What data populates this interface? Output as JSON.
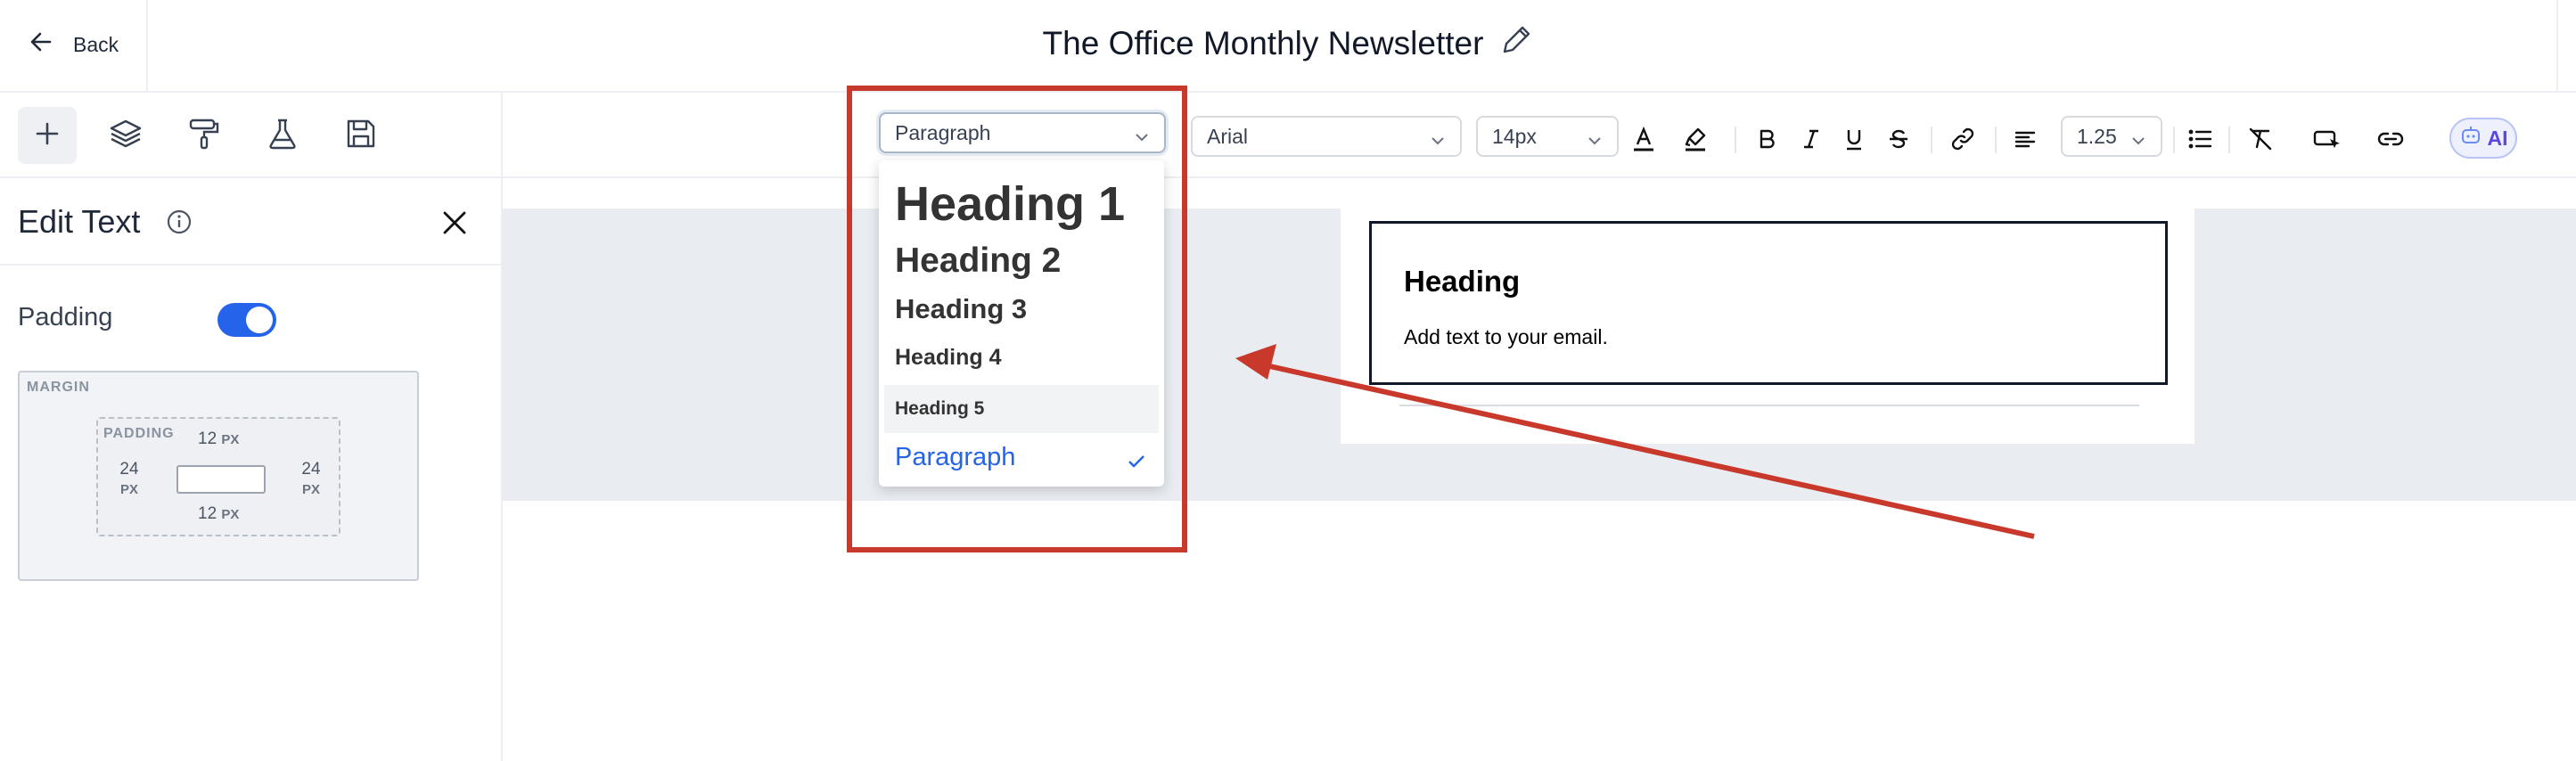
{
  "header": {
    "back_label": "Back",
    "title": "The Office Monthly Newsletter"
  },
  "left_toolbar": {
    "items": [
      {
        "name": "add-icon"
      },
      {
        "name": "layers-icon"
      },
      {
        "name": "paint-roller-icon"
      },
      {
        "name": "flask-icon"
      },
      {
        "name": "save-icon"
      }
    ]
  },
  "format_toolbar": {
    "block_type": "Paragraph",
    "font_family": "Arial",
    "font_size": "14px",
    "line_height": "1.25",
    "ai_label": "AI",
    "accent_color": "#2563eb"
  },
  "block_type_menu": {
    "options": [
      "Heading 1",
      "Heading 2",
      "Heading 3",
      "Heading 4",
      "Heading 5",
      "Paragraph"
    ],
    "selected": "Paragraph",
    "hovered": "Heading 5"
  },
  "panel": {
    "title": "Edit Text",
    "padding_label": "Padding",
    "padding_enabled": true,
    "margin_label": "MARGIN",
    "padding_box_label": "PADDING",
    "unit": "PX",
    "padding": {
      "top": "12",
      "right": "24",
      "bottom": "12",
      "left": "24"
    }
  },
  "canvas": {
    "heading": "Heading",
    "body": "Add text to your email."
  },
  "annotation": {
    "color": "#c8382b"
  }
}
